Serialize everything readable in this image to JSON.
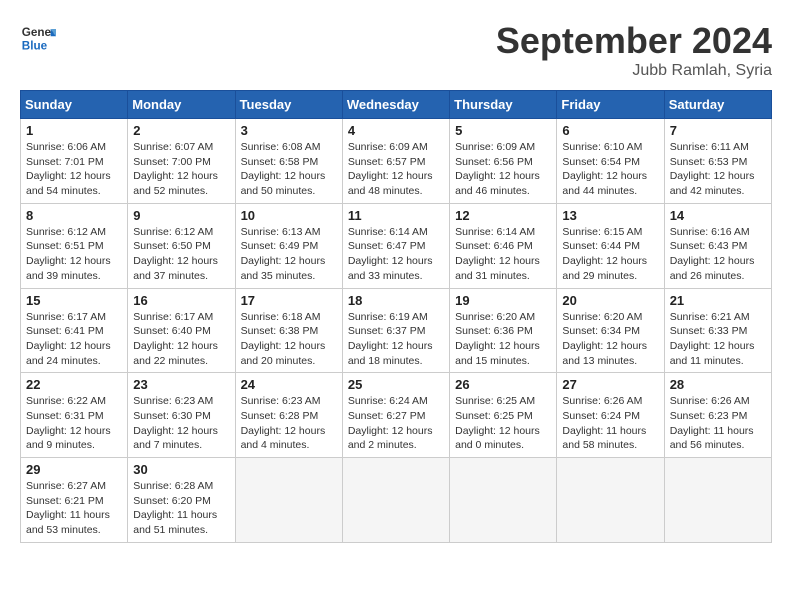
{
  "header": {
    "logo_line1": "General",
    "logo_line2": "Blue",
    "month": "September 2024",
    "location": "Jubb Ramlah, Syria"
  },
  "days_of_week": [
    "Sunday",
    "Monday",
    "Tuesday",
    "Wednesday",
    "Thursday",
    "Friday",
    "Saturday"
  ],
  "weeks": [
    [
      {
        "day": "1",
        "sunrise": "6:06 AM",
        "sunset": "7:01 PM",
        "daylight": "12 hours and 54 minutes."
      },
      {
        "day": "2",
        "sunrise": "6:07 AM",
        "sunset": "7:00 PM",
        "daylight": "12 hours and 52 minutes."
      },
      {
        "day": "3",
        "sunrise": "6:08 AM",
        "sunset": "6:58 PM",
        "daylight": "12 hours and 50 minutes."
      },
      {
        "day": "4",
        "sunrise": "6:09 AM",
        "sunset": "6:57 PM",
        "daylight": "12 hours and 48 minutes."
      },
      {
        "day": "5",
        "sunrise": "6:09 AM",
        "sunset": "6:56 PM",
        "daylight": "12 hours and 46 minutes."
      },
      {
        "day": "6",
        "sunrise": "6:10 AM",
        "sunset": "6:54 PM",
        "daylight": "12 hours and 44 minutes."
      },
      {
        "day": "7",
        "sunrise": "6:11 AM",
        "sunset": "6:53 PM",
        "daylight": "12 hours and 42 minutes."
      }
    ],
    [
      {
        "day": "8",
        "sunrise": "6:12 AM",
        "sunset": "6:51 PM",
        "daylight": "12 hours and 39 minutes."
      },
      {
        "day": "9",
        "sunrise": "6:12 AM",
        "sunset": "6:50 PM",
        "daylight": "12 hours and 37 minutes."
      },
      {
        "day": "10",
        "sunrise": "6:13 AM",
        "sunset": "6:49 PM",
        "daylight": "12 hours and 35 minutes."
      },
      {
        "day": "11",
        "sunrise": "6:14 AM",
        "sunset": "6:47 PM",
        "daylight": "12 hours and 33 minutes."
      },
      {
        "day": "12",
        "sunrise": "6:14 AM",
        "sunset": "6:46 PM",
        "daylight": "12 hours and 31 minutes."
      },
      {
        "day": "13",
        "sunrise": "6:15 AM",
        "sunset": "6:44 PM",
        "daylight": "12 hours and 29 minutes."
      },
      {
        "day": "14",
        "sunrise": "6:16 AM",
        "sunset": "6:43 PM",
        "daylight": "12 hours and 26 minutes."
      }
    ],
    [
      {
        "day": "15",
        "sunrise": "6:17 AM",
        "sunset": "6:41 PM",
        "daylight": "12 hours and 24 minutes."
      },
      {
        "day": "16",
        "sunrise": "6:17 AM",
        "sunset": "6:40 PM",
        "daylight": "12 hours and 22 minutes."
      },
      {
        "day": "17",
        "sunrise": "6:18 AM",
        "sunset": "6:38 PM",
        "daylight": "12 hours and 20 minutes."
      },
      {
        "day": "18",
        "sunrise": "6:19 AM",
        "sunset": "6:37 PM",
        "daylight": "12 hours and 18 minutes."
      },
      {
        "day": "19",
        "sunrise": "6:20 AM",
        "sunset": "6:36 PM",
        "daylight": "12 hours and 15 minutes."
      },
      {
        "day": "20",
        "sunrise": "6:20 AM",
        "sunset": "6:34 PM",
        "daylight": "12 hours and 13 minutes."
      },
      {
        "day": "21",
        "sunrise": "6:21 AM",
        "sunset": "6:33 PM",
        "daylight": "12 hours and 11 minutes."
      }
    ],
    [
      {
        "day": "22",
        "sunrise": "6:22 AM",
        "sunset": "6:31 PM",
        "daylight": "12 hours and 9 minutes."
      },
      {
        "day": "23",
        "sunrise": "6:23 AM",
        "sunset": "6:30 PM",
        "daylight": "12 hours and 7 minutes."
      },
      {
        "day": "24",
        "sunrise": "6:23 AM",
        "sunset": "6:28 PM",
        "daylight": "12 hours and 4 minutes."
      },
      {
        "day": "25",
        "sunrise": "6:24 AM",
        "sunset": "6:27 PM",
        "daylight": "12 hours and 2 minutes."
      },
      {
        "day": "26",
        "sunrise": "6:25 AM",
        "sunset": "6:25 PM",
        "daylight": "12 hours and 0 minutes."
      },
      {
        "day": "27",
        "sunrise": "6:26 AM",
        "sunset": "6:24 PM",
        "daylight": "11 hours and 58 minutes."
      },
      {
        "day": "28",
        "sunrise": "6:26 AM",
        "sunset": "6:23 PM",
        "daylight": "11 hours and 56 minutes."
      }
    ],
    [
      {
        "day": "29",
        "sunrise": "6:27 AM",
        "sunset": "6:21 PM",
        "daylight": "11 hours and 53 minutes."
      },
      {
        "day": "30",
        "sunrise": "6:28 AM",
        "sunset": "6:20 PM",
        "daylight": "11 hours and 51 minutes."
      },
      null,
      null,
      null,
      null,
      null
    ]
  ]
}
